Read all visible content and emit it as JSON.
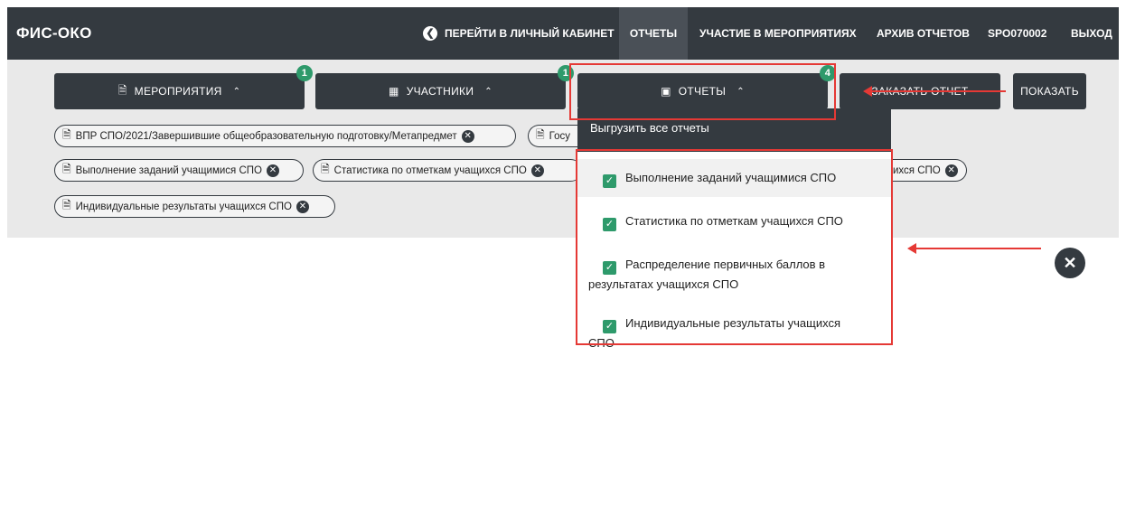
{
  "navbar": {
    "brand": "ФИС-ОКО",
    "cabinet_icon": "chevron-left-circle-icon",
    "cabinet": "ПЕРЕЙТИ В ЛИЧНЫЙ КАБИНЕТ",
    "reports": "ОТЧЕТЫ",
    "events": "УЧАСТИЕ В МЕРОПРИЯТИЯХ",
    "archive": "АРХИВ ОТЧЕТОВ",
    "user": "SPO070002",
    "exit": "ВЫХОД"
  },
  "filters": {
    "events": {
      "icon": "document-icon",
      "label": "МЕРОПРИЯТИЯ",
      "badge": "1"
    },
    "participants": {
      "icon": "building-icon",
      "label": "УЧАСТНИКИ",
      "badge": "1"
    },
    "reports": {
      "icon": "bar-chart-icon",
      "label": "ОТЧЕТЫ",
      "badge": "4"
    },
    "order": "ЗАКАЗАТЬ ОТЧЕТ",
    "show": "ПОКАЗАТЬ"
  },
  "chips": [
    {
      "label": "ВПР СПО/2021/Завершившие общеобразовательную подготовку/Метапредмет"
    },
    {
      "label": "Госу"
    },
    {
      "label": "Выполнение заданий учащимися СПО"
    },
    {
      "label": "Статистика по отметкам учащихся СПО"
    },
    {
      "label": "ихся СПО"
    },
    {
      "label": "Индивидуальные результаты учащихся СПО"
    }
  ],
  "dropdown": {
    "header": "Выгрузить все отчеты",
    "items": [
      {
        "label": "Выполнение заданий учащимися СПО",
        "checked": true
      },
      {
        "label": "Статистика по отметкам учащихся СПО",
        "checked": true
      },
      {
        "label": "Распределение первичных баллов в результатах учащихся СПО",
        "checked": true
      },
      {
        "label": "Индивидуальные результаты учащихся СПО",
        "checked": true
      }
    ]
  },
  "colors": {
    "navbar": "#343a40",
    "accent_green": "#2e9a6b",
    "annotation_red": "#e53935",
    "panel_bg": "#e9e9e9"
  }
}
